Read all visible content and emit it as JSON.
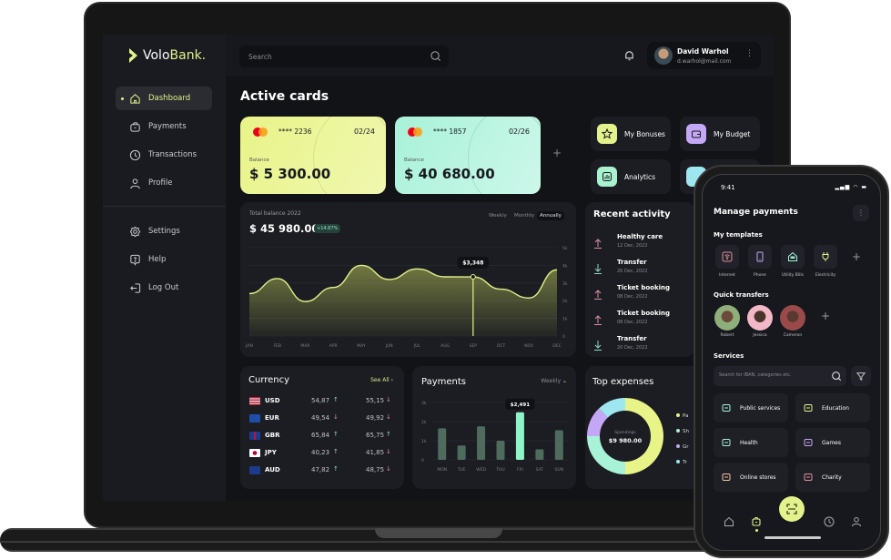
{
  "app": {
    "brand_primary": "Volo",
    "brand_accent": "Bank.",
    "accent_color": "#e3f28a"
  },
  "search": {
    "placeholder": "Search"
  },
  "user": {
    "name": "David Warhol",
    "email": "d.warhol@mail.com"
  },
  "sidebar": {
    "items": [
      {
        "label": "Dashboard",
        "icon": "home-icon",
        "active": true
      },
      {
        "label": "Payments",
        "icon": "wallet-icon"
      },
      {
        "label": "Transactions",
        "icon": "clock-icon"
      },
      {
        "label": "Profile",
        "icon": "user-icon"
      }
    ],
    "bottom_items": [
      {
        "label": "Settings",
        "icon": "gear-icon"
      },
      {
        "label": "Help",
        "icon": "help-icon"
      },
      {
        "label": "Log Out",
        "icon": "logout-icon"
      }
    ]
  },
  "main": {
    "title": "Active cards",
    "cards": [
      {
        "number": "**** 2236",
        "expiry": "02/24",
        "balance_label": "Balance",
        "balance": "$ 5 300.00"
      },
      {
        "number": "**** 1857",
        "expiry": "02/26",
        "balance_label": "Balance",
        "balance": "$ 40 680.00"
      }
    ],
    "add_card": "+",
    "quick_actions": [
      {
        "label": "My Bonuses",
        "icon": "star-icon",
        "color": "#e3f28a"
      },
      {
        "label": "My Budget",
        "icon": "wallet-icon",
        "color": "#c4a8f5"
      },
      {
        "label": "Analytics",
        "icon": "chart-icon",
        "color": "#a8f2d0"
      },
      {
        "label": "",
        "icon": "more-icon",
        "color": "#9ee6f0"
      }
    ],
    "balance": {
      "label": "Total balance 2022",
      "amount": "$ 45 980.00",
      "change": "+14.87%",
      "periods": [
        "Weekly",
        "Monthly",
        "Annually"
      ],
      "active_period": "Annually"
    },
    "recent_activity": {
      "title": "Recent activity",
      "items": [
        {
          "name": "Healthy care",
          "date": "12 Dec, 2022",
          "direction": "out"
        },
        {
          "name": "Transfer",
          "date": "20 Dec, 2022",
          "direction": "in"
        },
        {
          "name": "Ticket booking",
          "date": "08 Dec, 2022",
          "direction": "out"
        },
        {
          "name": "Ticket booking",
          "date": "08 Dec, 2022",
          "direction": "out"
        },
        {
          "name": "Transfer",
          "date": "20 Dec, 2022",
          "direction": "in"
        }
      ]
    },
    "currency": {
      "title": "Currency",
      "see_all": "See All",
      "rows": [
        {
          "code": "USD",
          "buy": "54,87",
          "buy_dir": "up",
          "sell": "55,15",
          "sell_dir": "down"
        },
        {
          "code": "EUR",
          "buy": "49,54",
          "buy_dir": "down",
          "sell": "49,92",
          "sell_dir": "down"
        },
        {
          "code": "GBR",
          "buy": "65,84",
          "buy_dir": "up",
          "sell": "65,75",
          "sell_dir": "up"
        },
        {
          "code": "JPY",
          "buy": "40,23",
          "buy_dir": "up",
          "sell": "41,85",
          "sell_dir": "down"
        },
        {
          "code": "AUD",
          "buy": "47,82",
          "buy_dir": "up",
          "sell": "48,75",
          "sell_dir": "down"
        }
      ]
    },
    "payments": {
      "title": "Payments",
      "period": "Weekly"
    },
    "top_expenses": {
      "title": "Top expenses",
      "center_label": "Spendings",
      "center_amount": "$9 980.00",
      "legend": [
        {
          "label": "Pa",
          "color": "#e8f488"
        },
        {
          "label": "Sh",
          "color": "#a8f2d8"
        },
        {
          "label": "Gr",
          "color": "#c4a8f5"
        },
        {
          "label": "Tr",
          "color": "#9ee6f0"
        }
      ]
    }
  },
  "chart_data": [
    {
      "type": "area",
      "title": "Total balance 2022",
      "categories": [
        "JAN",
        "FEB",
        "MAR",
        "APR",
        "MAY",
        "JUN",
        "JUL",
        "AUG",
        "SEP",
        "OCT",
        "NOV",
        "DEC"
      ],
      "values": [
        2400,
        3250,
        1950,
        2750,
        4000,
        3200,
        3800,
        3350,
        3348,
        2650,
        2150,
        3750
      ],
      "yticks": [
        "0",
        "1k",
        "2k",
        "3k",
        "4k",
        "5k"
      ],
      "ylim": [
        0,
        5000
      ],
      "highlight": {
        "category": "SEP",
        "label": "$3,348"
      },
      "grid": true
    },
    {
      "type": "bar",
      "title": "Payments",
      "categories": [
        "MON",
        "TUE",
        "WED",
        "THU",
        "FRI",
        "SAT",
        "SUN"
      ],
      "values": [
        1650,
        750,
        1750,
        1000,
        2491,
        550,
        1550
      ],
      "yticks": [
        "0",
        "1k",
        "2k",
        "3k"
      ],
      "ylim": [
        0,
        3000
      ],
      "highlight": {
        "category": "FRI",
        "label": "$2,491"
      }
    },
    {
      "type": "pie",
      "title": "Top expenses",
      "labels": [
        "Pa",
        "Sh",
        "Gr",
        "Tr"
      ],
      "values": [
        50,
        25,
        13,
        12
      ]
    }
  ],
  "phone": {
    "time": "9:41",
    "title": "Manage payments",
    "templates_title": "My templates",
    "templates": [
      {
        "label": "Internet",
        "icon": "wifi-icon",
        "color": "#e08ea0"
      },
      {
        "label": "Phone",
        "icon": "phone-icon",
        "color": "#c4a8f5"
      },
      {
        "label": "Utility Bills",
        "icon": "house-icon",
        "color": "#a8f2d8"
      },
      {
        "label": "Electricity",
        "icon": "plug-icon",
        "color": "#e3f28a"
      }
    ],
    "quick_transfers_title": "Quick transfers",
    "contacts": [
      {
        "name": "Robert",
        "color": "#8fae7a"
      },
      {
        "name": "Jessica",
        "color": "#f2b8c8"
      },
      {
        "name": "Cameron",
        "color": "#9a4a4a"
      }
    ],
    "services_title": "Services",
    "search_placeholder": "Search for IBAN, categories etc.",
    "services": [
      {
        "label": "Public services",
        "icon": "bank-icon",
        "color": "#a8f2d8"
      },
      {
        "label": "Education",
        "icon": "education-icon",
        "color": "#e3f28a"
      },
      {
        "label": "Health",
        "icon": "health-icon",
        "color": "#a8f2d8"
      },
      {
        "label": "Games",
        "icon": "games-icon",
        "color": "#c4a8f5"
      },
      {
        "label": "Online stores",
        "icon": "cart-icon",
        "color": "#f0c89a"
      },
      {
        "label": "Charity",
        "icon": "charity-icon",
        "color": "#e08ea0"
      }
    ]
  }
}
